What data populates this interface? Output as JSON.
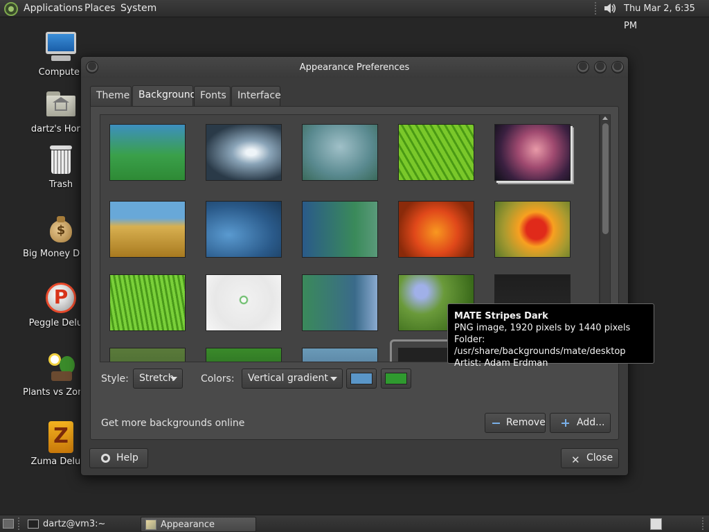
{
  "top_panel": {
    "menus": [
      "Applications",
      "Places",
      "System"
    ],
    "clock": "Thu Mar  2,  6:35 PM"
  },
  "desktop_icons": [
    {
      "label": "Computer",
      "icon": "computer-icon"
    },
    {
      "label": "dartz's Home",
      "icon": "home-folder-icon"
    },
    {
      "label": "Trash",
      "icon": "trash-icon"
    },
    {
      "label": "Big Money Deluxe",
      "icon": "money-bag-icon"
    },
    {
      "label": "Peggle Deluxe",
      "icon": "peggle-icon"
    },
    {
      "label": "Plants vs Zombies",
      "icon": "plants-icon"
    },
    {
      "label": "Zuma Deluxe",
      "icon": "zuma-icon"
    }
  ],
  "window": {
    "title": "Appearance Preferences",
    "tabs": [
      "Theme",
      "Background",
      "Fonts",
      "Interface"
    ],
    "active_tab": "Background",
    "style_label": "Style:",
    "style_value": "Stretch",
    "colors_label": "Colors:",
    "colors_value": "Vertical gradient",
    "primary_color": "#5a96c8",
    "secondary_color": "#2f9a2f",
    "get_more": "Get more backgrounds online",
    "remove_label": "Remove",
    "add_label": "Add...",
    "help_label": "Help",
    "close_label": "Close"
  },
  "tooltip": {
    "title": "MATE Stripes Dark",
    "line1": "PNG image, 1920 pixels by 1440 pixels",
    "line2": "Folder: /usr/share/backgrounds/mate/desktop",
    "line3": "Artist: Adam Erdman"
  },
  "taskbar": {
    "items": [
      "dartz@vm3:~",
      "Appearance Prefere..."
    ]
  }
}
